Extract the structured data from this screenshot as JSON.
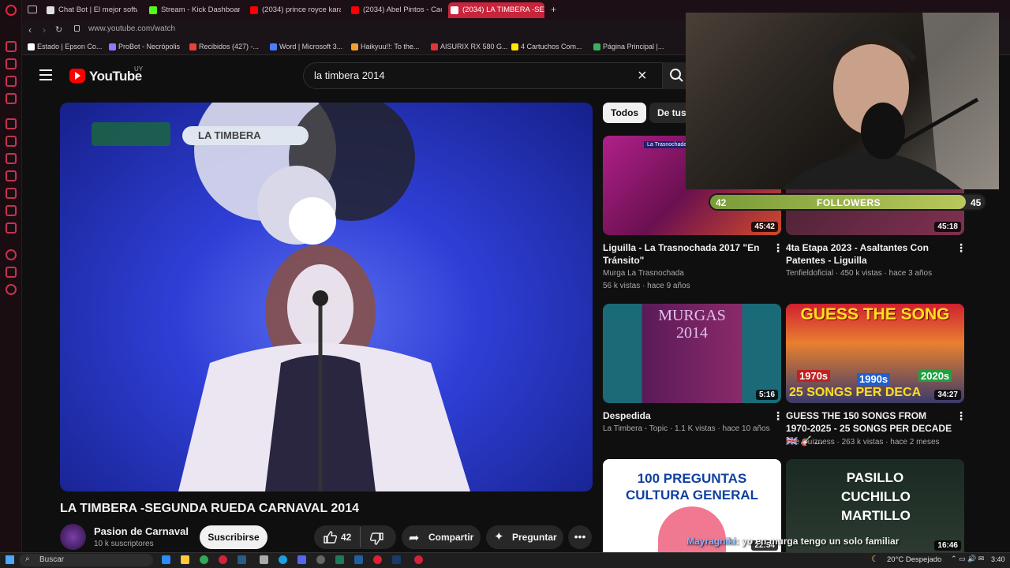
{
  "browser": {
    "tabs": [
      {
        "label": "Chat Bot | El mejor softwa",
        "color": "#e0e0e0"
      },
      {
        "label": "Stream - Kick Dashboard",
        "color": "#53fc18"
      },
      {
        "label": "(2034) prince royce karao",
        "color": "#ff0000"
      },
      {
        "label": "(2034) Abel Pintos - Cact",
        "color": "#ff0000"
      },
      {
        "label": "(2034) LA TIMBERA -SEGU",
        "color": "#ff0000"
      }
    ],
    "new_tab": "+",
    "url": "www.youtube.com/watch",
    "bookmarks": [
      {
        "label": "Estado | Epson Co...",
        "color": "#ffffff"
      },
      {
        "label": "ProBot - Necrópolis",
        "color": "#8a7cff"
      },
      {
        "label": "Recibidos (427) -...",
        "color": "#ea4335"
      },
      {
        "label": "Word | Microsoft 3...",
        "color": "#4a7cff"
      },
      {
        "label": "Haikyuu!!: To the...",
        "color": "#f0a030"
      },
      {
        "label": "AISURIX RX 580 G...",
        "color": "#e53238"
      },
      {
        "label": "4 Cartuchos Com...",
        "color": "#ffe600"
      },
      {
        "label": "Página Principal |...",
        "color": "#3aaf5c"
      }
    ]
  },
  "youtube": {
    "logo": "YouTube",
    "country": "UY",
    "search": {
      "query": "la timbera 2014",
      "clear": "×",
      "icon": "search-icon"
    },
    "video": {
      "overlay_label": "LA TIMBERA",
      "title": "LA TIMBERA -SEGUNDA RUEDA CARNAVAL 2014",
      "channel": "Pasion de Carnaval",
      "subscribers": "10 k suscriptores",
      "subscribe": "Suscribirse",
      "likes": "42",
      "share": "Compartir",
      "ask": "Preguntar",
      "more": "•••"
    },
    "chips": [
      "Todos",
      "De tus"
    ],
    "recommendations": [
      {
        "title": "Liguilla - La Trasnochada 2017 \"En Tránsito\"",
        "channel": "Murga La Trasnochada",
        "stats": "56 k vistas · hace 9 años",
        "duration": "45:42",
        "thumb_text": "La Trasnochada"
      },
      {
        "title": "4ta Etapa 2023 - Asaltantes Con Patentes - Liguilla",
        "channel": "Tenfieldoficial",
        "stats": "450 k vistas · hace 3 años",
        "duration": "45:18",
        "thumb_text": ""
      },
      {
        "title": "Despedida",
        "channel": "La Timbera - Topic",
        "stats": "1.1 K vistas · hace 10 años",
        "duration": "5:16",
        "thumb_text": "MURGAS 2014"
      },
      {
        "title": "GUESS THE 150 SONGS FROM 1970-2025 - 25 SONGS PER DECADE🇬🇧 🎸 ...",
        "channel": "The Quizness",
        "stats": "263 k vistas · hace 2 meses",
        "duration": "34:27",
        "thumb_text": "GUESS THE SONG"
      },
      {
        "title": "",
        "channel": "",
        "stats": "",
        "duration": "22:54",
        "thumb_text": "100 PREGUNTAS CULTURA GENERAL"
      },
      {
        "title": "",
        "channel": "",
        "stats": "",
        "duration": "16:46",
        "thumb_text": "PASILLO CUCHILLO MARTILLO"
      }
    ],
    "thumb_badges": {
      "d1970": "1970s",
      "d1990": "1990s",
      "d2020": "2020s",
      "songs": "25 SONGS PER DECA"
    }
  },
  "stream": {
    "followers_current": "42",
    "followers_label": "FOLLOWERS",
    "followers_goal": "45",
    "followers_progress": 0.93,
    "chat_user": "Mayragniki",
    "chat_text": ": yo en murga tengo un solo familiar"
  },
  "taskbar": {
    "search": "Buscar",
    "weather": "20°C  Despejado",
    "time": "3:40"
  }
}
